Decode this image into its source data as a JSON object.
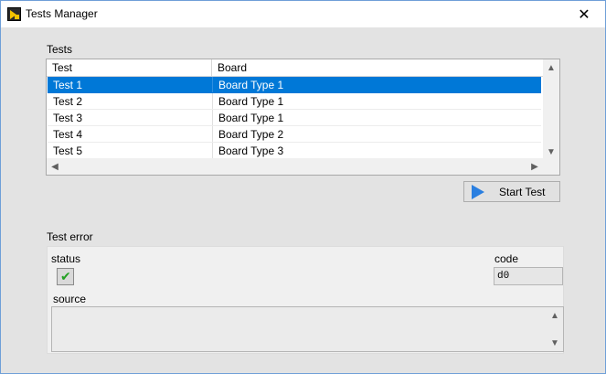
{
  "window": {
    "title": "Tests Manager",
    "close_glyph": "✕"
  },
  "tests": {
    "label": "Tests",
    "columns": [
      "Test",
      "Board"
    ],
    "rows": [
      {
        "test": "Test 1",
        "board": "Board Type 1",
        "selected": true
      },
      {
        "test": "Test 2",
        "board": "Board Type 1",
        "selected": false
      },
      {
        "test": "Test 3",
        "board": "Board Type 1",
        "selected": false
      },
      {
        "test": "Test 4",
        "board": "Board Type 2",
        "selected": false
      },
      {
        "test": "Test 5",
        "board": "Board Type 3",
        "selected": false
      }
    ],
    "selection_color": "#0078d7"
  },
  "start_button": {
    "label": "Start Test",
    "icon": "play-icon",
    "icon_color": "#2a7fe0"
  },
  "test_error": {
    "label": "Test error",
    "status_label": "status",
    "status_icon": "check-icon",
    "status_color": "#22a022",
    "code_label": "code",
    "code_value": "d0",
    "source_label": "source",
    "source_value": ""
  }
}
